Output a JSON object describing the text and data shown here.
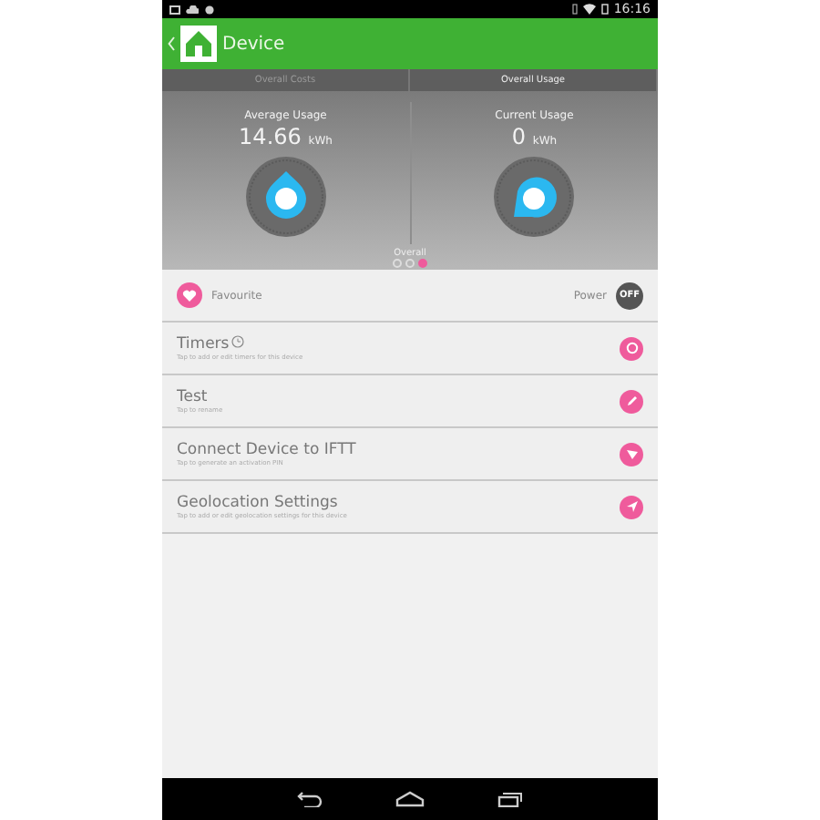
{
  "status_bar": {
    "time": "16:16"
  },
  "header": {
    "title": "Device"
  },
  "tabs": [
    {
      "label": "Overall Costs",
      "selected": false
    },
    {
      "label": "Overall Usage",
      "selected": true
    }
  ],
  "gauges": [
    {
      "label": "Average Usage",
      "value": "14.66",
      "unit": "kWh"
    },
    {
      "label": "Current Usage",
      "value": "0",
      "unit": "kWh"
    }
  ],
  "pager": {
    "label": "Overall",
    "dots": [
      {
        "selected": false
      },
      {
        "selected": false
      },
      {
        "selected": true
      }
    ]
  },
  "favourite": {
    "label": "Favourite",
    "power_label": "Power",
    "power_on": false,
    "power_text": "OFF"
  },
  "rows": [
    {
      "kind": "timer",
      "title": "Timers",
      "subtitle": "Tap to add or edit timers for this device"
    },
    {
      "kind": "edit",
      "title": "Test",
      "subtitle": "Tap to rename"
    },
    {
      "kind": "link",
      "title": "Connect Device to IFTT",
      "subtitle": "Tap to generate an activation PIN"
    },
    {
      "kind": "location",
      "title": "Geolocation Settings",
      "subtitle": "Tap to add or edit geolocation settings for this device"
    }
  ]
}
